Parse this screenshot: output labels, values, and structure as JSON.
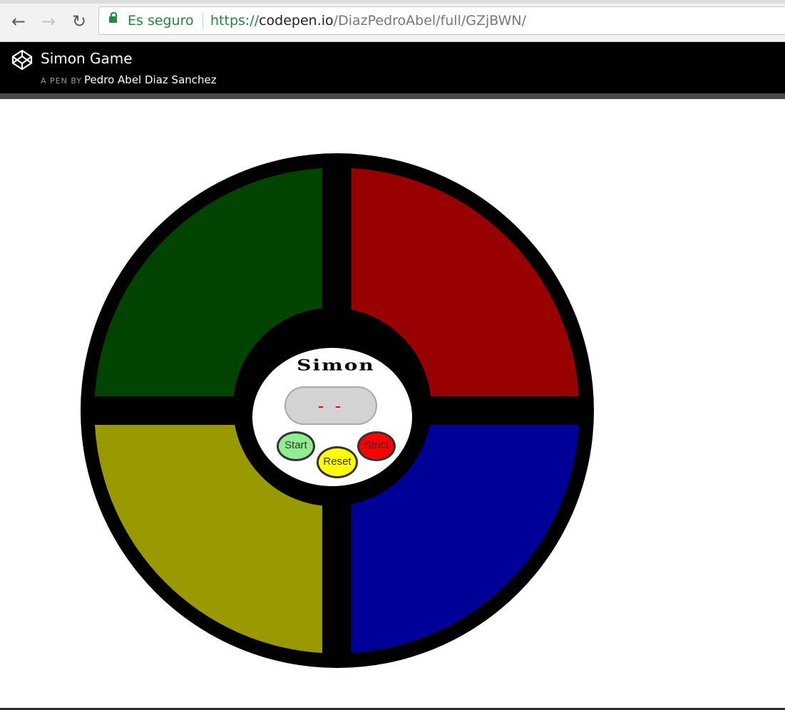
{
  "browser": {
    "back_glyph": "←",
    "forward_glyph": "→",
    "reload_glyph": "↻",
    "secure_label": "Es seguro",
    "url": {
      "scheme": "https://",
      "host": "codepen.io",
      "path": "/DiazPedroAbel/full/GZjBWN/"
    }
  },
  "header": {
    "title": "Simon Game",
    "by_prefix": "A PEN BY",
    "author": "Pedro Abel Diaz Sanchez"
  },
  "game": {
    "title": "Simon",
    "count_display": "- -",
    "start_label": "Start",
    "reset_label": "Reset",
    "strict_label": "Strict",
    "colors": {
      "green": "#004400",
      "red": "#990000",
      "yellow": "#999900",
      "blue": "#000099",
      "start": "#90ee90",
      "reset": "#ffff00",
      "strict": "#ff0000"
    }
  }
}
